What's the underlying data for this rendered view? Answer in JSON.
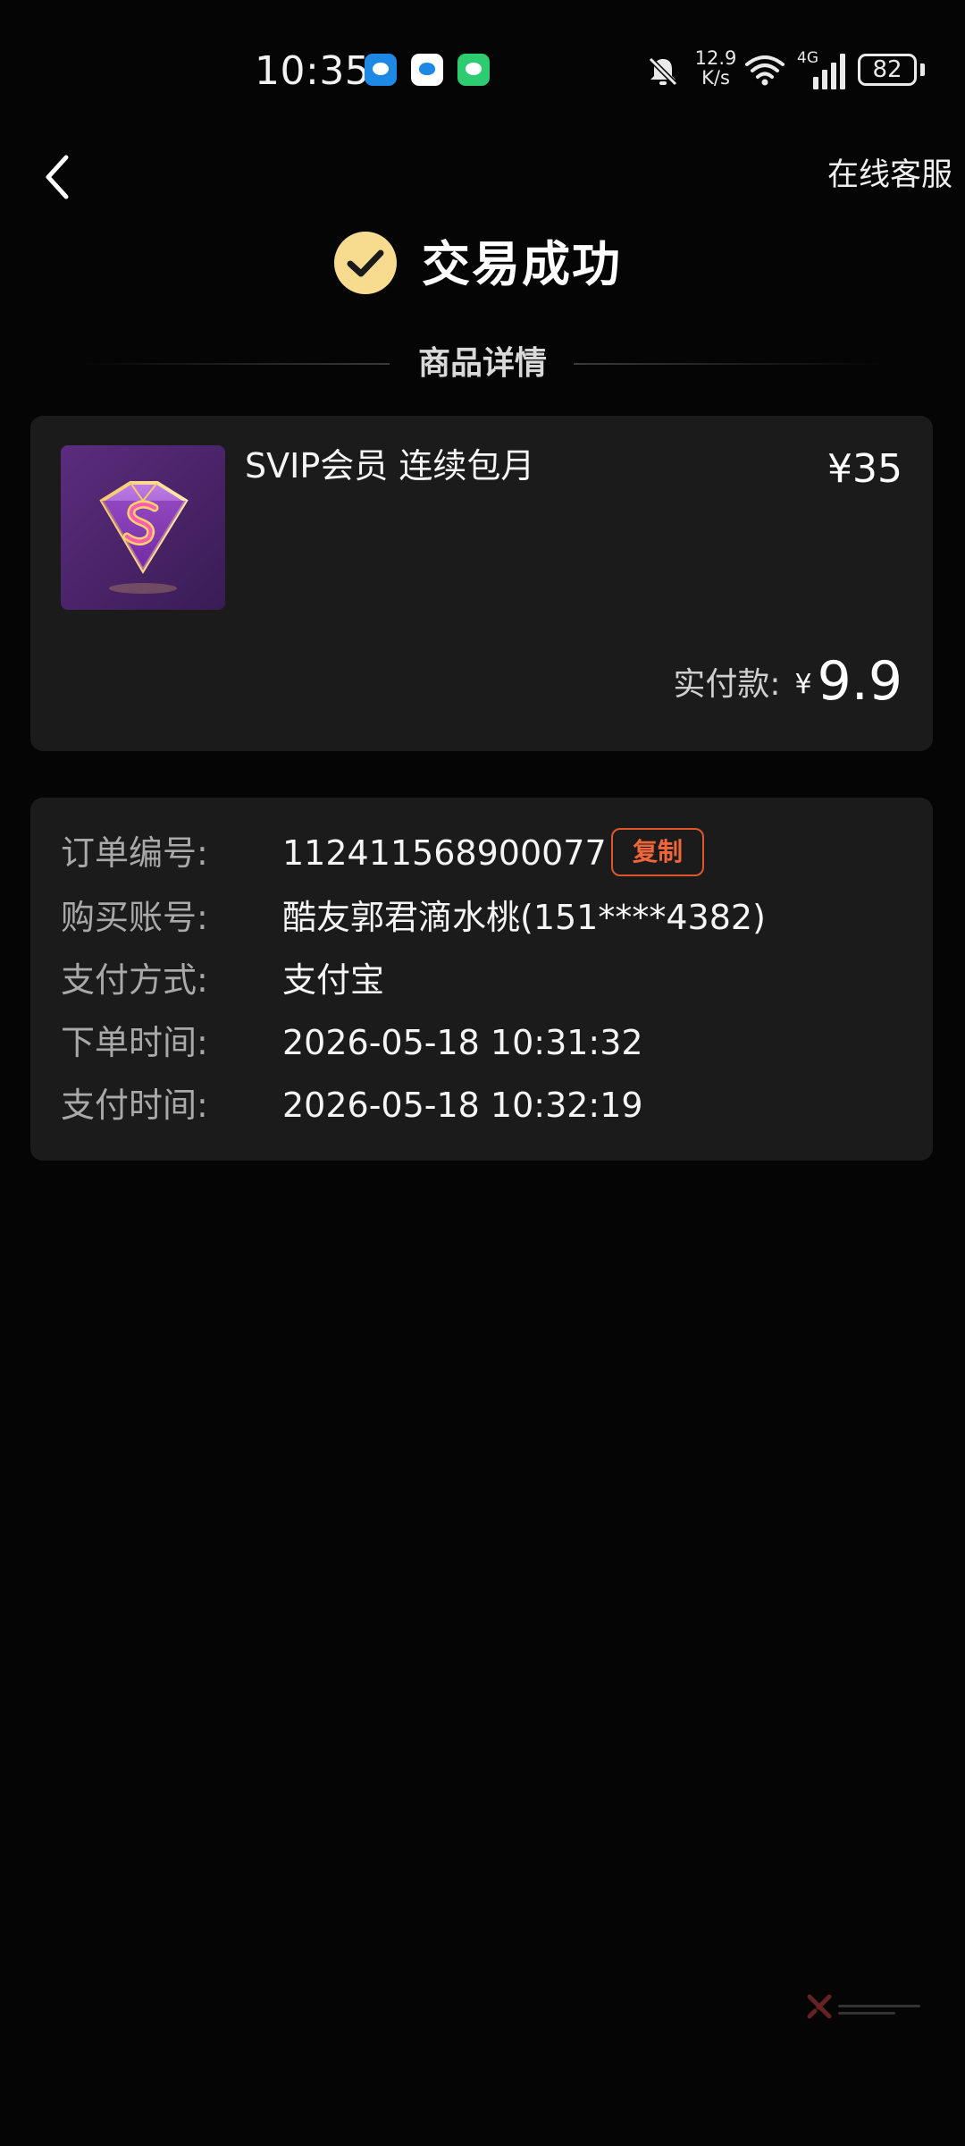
{
  "status_bar": {
    "time": "10:35",
    "net_speed_value": "12.9",
    "net_speed_unit": "K/s",
    "network_type": "4G",
    "battery_level": "82"
  },
  "nav": {
    "support_label": "在线客服"
  },
  "header": {
    "status_title": "交易成功"
  },
  "product_section": {
    "title": "商品详情",
    "name": "SVIP会员 连续包月",
    "price": "¥35",
    "paid_label": "实付款:",
    "paid_currency": "¥",
    "paid_amount": "9.9"
  },
  "order_info": {
    "rows": [
      {
        "label": "订单编号:",
        "value": "112411568900077"
      },
      {
        "label": "购买账号:",
        "value": "酷友郭君滴水桃(151****4382)"
      },
      {
        "label": "支付方式:",
        "value": "支付宝"
      },
      {
        "label": "下单时间:",
        "value": "2026-05-18 10:31:32"
      },
      {
        "label": "支付时间:",
        "value": "2026-05-18 10:32:19"
      }
    ],
    "copy_label": "复制"
  },
  "colors": {
    "background": "#050505",
    "card": "#1b1b1b",
    "success_badge": "#f7dc8f",
    "copy_accent": "#f0663a"
  }
}
